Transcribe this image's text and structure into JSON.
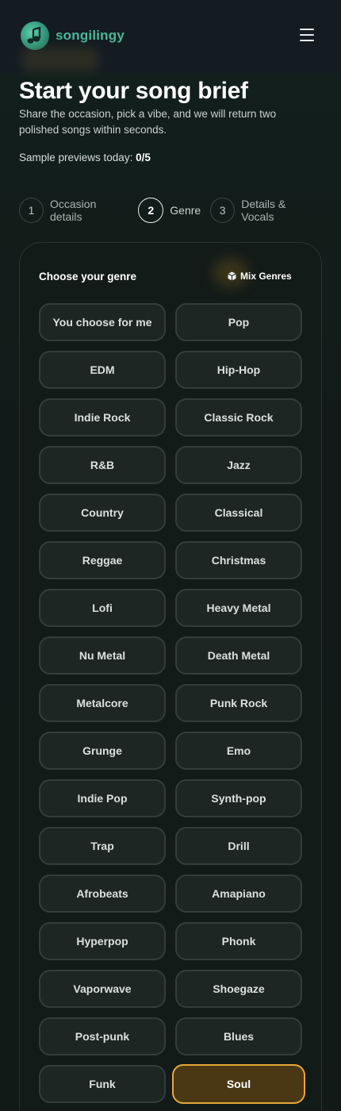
{
  "brand": {
    "name": "songilingy"
  },
  "header": {
    "title": "Start your song brief",
    "subtitle": "Share the occasion, pick a vibe, and we will return two polished songs within seconds."
  },
  "previews": {
    "label": "Sample previews today:",
    "value": "0/5"
  },
  "steps": [
    {
      "num": "1",
      "label": "Occasion details",
      "active": false
    },
    {
      "num": "2",
      "label": "Genre",
      "active": true
    },
    {
      "num": "3",
      "label": "Details & Vocals",
      "active": false
    }
  ],
  "genre_card": {
    "heading": "Choose your genre",
    "mix_label": "Mix Genres",
    "genres": [
      "You choose for me",
      "Pop",
      "EDM",
      "Hip-Hop",
      "Indie Rock",
      "Classic Rock",
      "R&B",
      "Jazz",
      "Country",
      "Classical",
      "Reggae",
      "Christmas",
      "Lofi",
      "Heavy Metal",
      "Nu Metal",
      "Death Metal",
      "Metalcore",
      "Punk Rock",
      "Grunge",
      "Emo",
      "Indie Pop",
      "Synth-pop",
      "Trap",
      "Drill",
      "Afrobeats",
      "Amapiano",
      "Hyperpop",
      "Phonk",
      "Vaporwave",
      "Shoegaze",
      "Post-punk",
      "Blues",
      "Funk",
      "Soul"
    ],
    "selected": "Soul"
  },
  "colors": {
    "accent": "#4bb797",
    "selected_border": "#e6a73b",
    "selected_fill": "#4a3714"
  },
  "icons": {
    "logo": "music-note-icon",
    "menu": "hamburger-menu-icon",
    "mix": "cube-icon"
  }
}
